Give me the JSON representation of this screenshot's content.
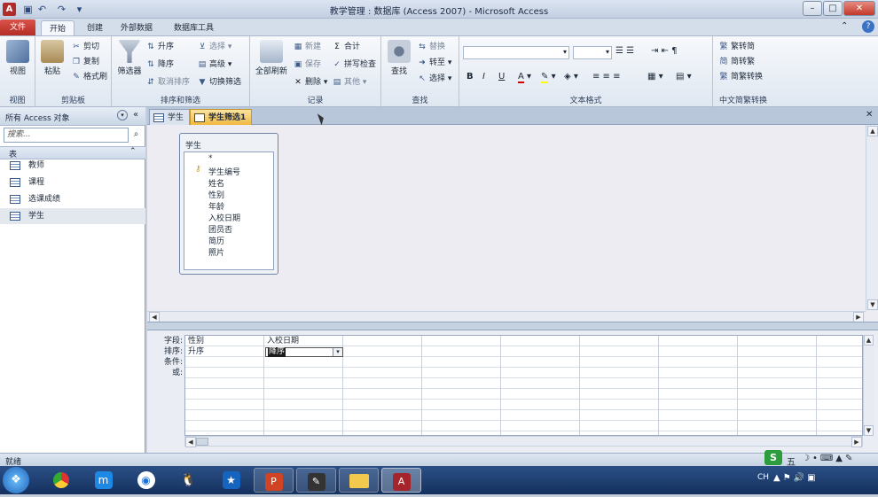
{
  "window": {
    "title": "教学管理 : 数据库 (Access 2007) - Microsoft Access",
    "app_icon_letter": "A",
    "min": "–",
    "max": "□",
    "close": "✕"
  },
  "ribbon_tabs": [
    "文件",
    "开始",
    "创建",
    "外部数据",
    "数据库工具"
  ],
  "ribbon": {
    "view": {
      "label": "视图",
      "group": "视图"
    },
    "clipboard": {
      "paste": "粘贴",
      "cut": "剪切",
      "copy": "复制",
      "format_painter": "格式刷",
      "group": "剪贴板"
    },
    "sort_filter": {
      "filter": "筛选器",
      "asc": "升序",
      "desc": "降序",
      "remove_sort": "取消排序",
      "selection": "选择",
      "advanced": "高级",
      "toggle_filter": "切换筛选",
      "group": "排序和筛选"
    },
    "records": {
      "refresh_all": "全部刷新",
      "new": "新建",
      "save": "保存",
      "delete": "删除",
      "totals": "合计",
      "spelling": "拼写检查",
      "more": "其他",
      "group": "记录"
    },
    "find": {
      "find": "查找",
      "replace": "替换",
      "goto": "转至",
      "select": "选择",
      "group": "查找"
    },
    "text_format": {
      "group": "文本格式",
      "bold": "B",
      "italic": "I",
      "underline": "U"
    },
    "chinese": {
      "to_simplified": "繁转简",
      "to_traditional": "简转繁",
      "convert": "简繁转换",
      "group": "中文简繁转换"
    }
  },
  "nav": {
    "header": "所有 Access 对象",
    "search_placeholder": "搜索...",
    "section": "表",
    "items": [
      "教师",
      "课程",
      "选课成绩",
      "学生"
    ]
  },
  "doc_tabs": [
    "学生",
    "学生筛选1"
  ],
  "table_box": {
    "title": "学生",
    "fields": [
      "*",
      "学生编号",
      "姓名",
      "性别",
      "年龄",
      "入校日期",
      "团员否",
      "简历",
      "照片"
    ]
  },
  "grid": {
    "row_labels": [
      "字段:",
      "排序:",
      "条件:",
      "或:"
    ],
    "col1": {
      "field": "性别",
      "sort": "升序"
    },
    "col2": {
      "field": "入校日期",
      "sort": "降序"
    }
  },
  "status": {
    "text": "就绪"
  },
  "taskbar": {
    "tray_lang": "CH",
    "ime": "五"
  },
  "colors": {
    "file_tab": "#b12b2b",
    "accent": "#f0b840",
    "taskbar": "#1c3c70"
  }
}
